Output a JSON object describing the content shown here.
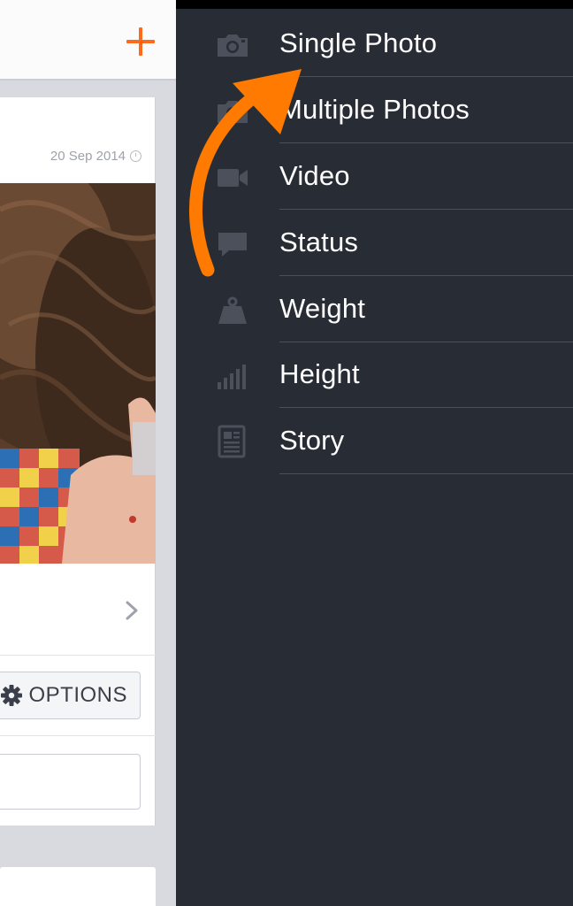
{
  "colors": {
    "accent": "#ff7a00",
    "drawer_bg": "#282c35",
    "menu_text": "#ffffff",
    "icon": "#4b505b"
  },
  "header": {
    "add_icon": "plus-icon"
  },
  "post": {
    "date": "20 Sep 2014",
    "clock_icon": "clock-icon",
    "chevron_icon": "chevron-right-icon",
    "options_icon": "gear-icon",
    "options_label": "OPTIONS",
    "comment_placeholder": ""
  },
  "drawer": {
    "items": [
      {
        "label": "Single Photo",
        "icon": "camera-icon"
      },
      {
        "label": "Multiple Photos",
        "icon": "camera-icon"
      },
      {
        "label": "Video",
        "icon": "video-camera-icon"
      },
      {
        "label": "Status",
        "icon": "speech-bubble-icon"
      },
      {
        "label": "Weight",
        "icon": "weight-icon"
      },
      {
        "label": "Height",
        "icon": "signal-bars-icon"
      },
      {
        "label": "Story",
        "icon": "document-icon"
      }
    ]
  },
  "tutorial_arrow_icon": "curved-arrow-icon"
}
